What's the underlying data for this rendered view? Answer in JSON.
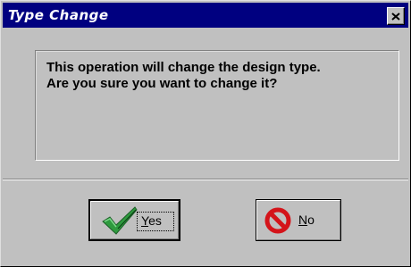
{
  "window": {
    "title": "Type Change"
  },
  "message": {
    "line1": "This operation will change the design type.",
    "line2": "Are you sure you want to change it?"
  },
  "buttons": {
    "yes": {
      "first": "Y",
      "rest": "es",
      "icon": "checkmark-icon"
    },
    "no": {
      "first": "N",
      "rest": "o",
      "icon": "prohibited-icon"
    }
  },
  "colors": {
    "titlebar": "#000080",
    "face": "#c0c0c0",
    "check_green": "#2e9a3e",
    "no_red": "#d4141a"
  }
}
